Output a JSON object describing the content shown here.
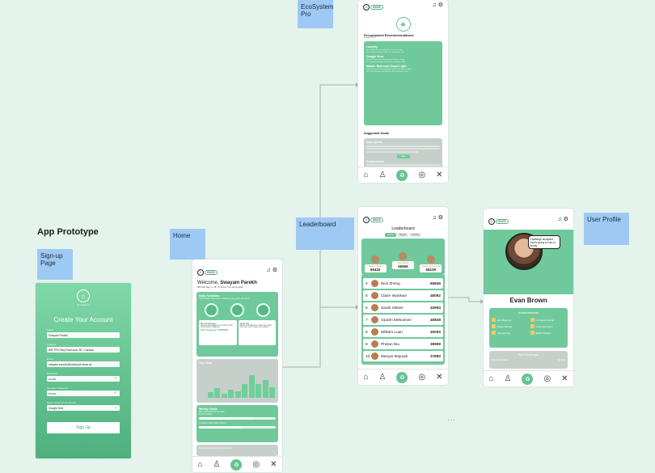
{
  "canvas": {
    "title": "App Prototype",
    "ellipsis": "...",
    "labels": {
      "signup": "Sign-up Page",
      "home": "Home",
      "ecosystem": "EcoSystem Pro",
      "leaderboard": "Leaderboard",
      "profile": "User Profile"
    }
  },
  "colors": {
    "primary": "#70c99b",
    "accent": "#67c392",
    "card_gray": "#c7cfcb",
    "sticky": "#9ec9f4",
    "canvas": "#e4f3ec"
  },
  "points_badge": "69420",
  "signup": {
    "brand": "EcoSystem",
    "heading": "Create Your Account",
    "fields": [
      {
        "label": "Name",
        "value": "Swayam Parekh",
        "check": ""
      },
      {
        "label": "Address",
        "value": "805 TRU Way Kamloops, BC, Canada",
        "check": ""
      },
      {
        "label": "Email",
        "value": "swayam.parekh@kamloops.shaw.ca",
        "check": ""
      },
      {
        "label": "Password",
        "value": "••••••••",
        "check": "✓"
      },
      {
        "label": "Re-enter Password",
        "value": "••••••••",
        "check": "✓"
      },
      {
        "label": "Select Smart Home Device",
        "value": "Google Nest",
        "check": "⌄"
      }
    ],
    "submit": "Sign Up"
  },
  "home": {
    "welcome_prefix": "Welcome, ",
    "welcome_name": "Swayam Parekh",
    "location": "805 TRU Way  |  ☀ 15°  It's Sunny! Turn off the lights",
    "daily_summary": {
      "title": "Daily Summary",
      "subtitle": "You're closer than ever to reaching your goals, let's do it.",
      "challenge_title": "My Challenges",
      "challenge_text": "Good to accomplish your monthly water conservation challenge.",
      "challenge_progress": "Your Progress: 4700/5000",
      "tip_title": "Daily Tip",
      "tip_text": "Mount a rain barrel to collect rain water from your roof to water your garden."
    },
    "your_data": {
      "title": "Your Data",
      "bars": [
        20,
        35,
        15,
        30,
        22,
        48,
        80,
        50,
        62,
        38
      ]
    },
    "weekly_goals": {
      "title": "Weekly Goals",
      "subtitle": "Plan your goals for the week",
      "items": [
        {
          "label": "Reduce Waste",
          "progress": 0.7
        },
        {
          "label": "Complete 5 Eco-Walk Projects",
          "progress": 0.55
        }
      ]
    },
    "monthly": "Ecoburners Monthly Challenge"
  },
  "eco": {
    "heading": "Personalized Recommendations",
    "powered": "Powered by AI",
    "recs": [
      {
        "title": "Laundry",
        "text": "Do laundry on non-peak hours to save energy.",
        "saving": "Est. Summer Savings: $30 / Est. EcoPoints: 120"
      },
      {
        "title": "Google Nest",
        "text": "Set your thermostat a few degrees lower at night.",
        "saving": "Est. Summer Savings: $150 / Est. EcoPoints: 190"
      },
      {
        "title": "Master Bedroom Smart Light",
        "text": "Switch to a warm-light schedule to dim the bedroom lights.",
        "saving": "Est. CO2 reduction: 400-800kg / Est. EcoPoints: 370"
      }
    ],
    "suggested": "Suggested Goals",
    "goals": [
      {
        "title": "Solar System",
        "text": "Challenge yourself to install a solar panel this year."
      },
      {
        "title": "Neighborhood",
        "text": "Join a community rain garden project."
      }
    ],
    "start": "Start"
  },
  "leader": {
    "title": "Leaderboard",
    "segments": [
      "Friends",
      "Region",
      "Country"
    ],
    "podium": [
      {
        "name": "Swayam Parekh",
        "score": "69420"
      },
      {
        "name": "Evan Brown",
        "score": "66666"
      },
      {
        "name": "Joseph Van Der Haar",
        "score": "58129"
      }
    ],
    "rows": [
      {
        "rank": "4",
        "name": "Nick Zheng",
        "score": "50845"
      },
      {
        "rank": "5",
        "name": "Claire Iwankow",
        "score": "45092"
      },
      {
        "rank": "6",
        "name": "Sarah Sikkes",
        "score": "43993"
      },
      {
        "rank": "7",
        "name": "Ciparin Mekonnen",
        "score": "40828"
      },
      {
        "rank": "8",
        "name": "William Luan",
        "score": "40000"
      },
      {
        "rank": "9",
        "name": "Phelan Niu",
        "score": "39999"
      },
      {
        "rank": "10",
        "name": "Mazyar Mojoudi",
        "score": "27890"
      }
    ]
  },
  "profile": {
    "quote": "Challenge accepted You're going to lose to buddy",
    "name": "Evan Brown",
    "achievements_title": "Achievements",
    "achievements": [
      "Eco Beginner",
      "Compost Champ",
      "Water Wizard",
      "Greenest Home",
      "Upcyclitying",
      "Water Wisdom"
    ],
    "past_title": "Past Challenges",
    "past_left": "Best Competition",
    "past_right": "You Win"
  }
}
